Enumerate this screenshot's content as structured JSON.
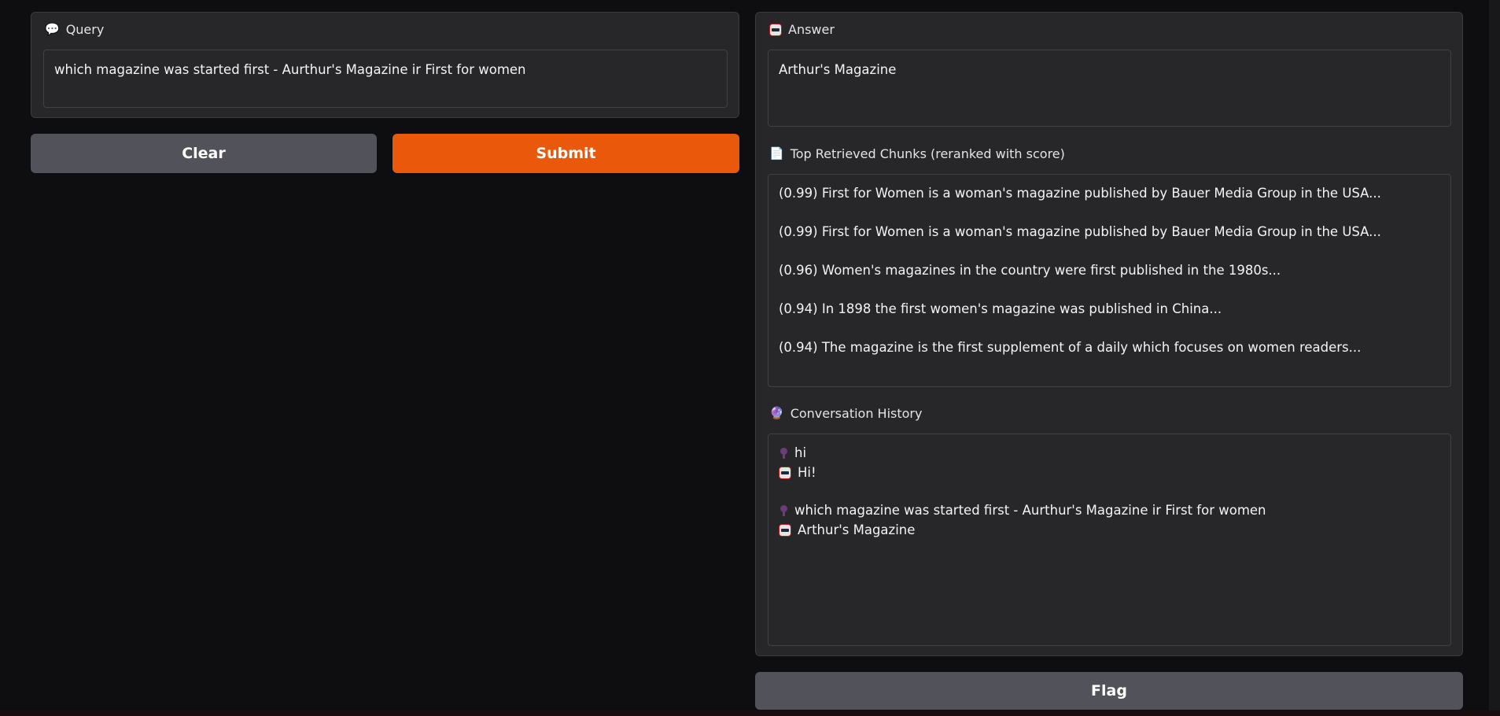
{
  "query": {
    "label": "Query",
    "icon": "speech-bubble-icon",
    "value": "which magazine was started first - Aurthur's Magazine ir First for women"
  },
  "buttons": {
    "clear": "Clear",
    "submit": "Submit",
    "flag": "Flag"
  },
  "answer": {
    "label": "Answer",
    "icon": "robot-icon",
    "value": "Arthur's Magazine"
  },
  "chunks": {
    "label": "Top Retrieved Chunks (reranked with score)",
    "icon": "page-icon",
    "items": [
      "(0.99) First for Women is a woman's magazine published by Bauer Media Group in the USA...",
      "(0.99) First for Women is a woman's magazine published by Bauer Media Group in the USA...",
      "(0.96) Women's magazines in the country were first published in the 1980s...",
      "(0.94) In 1898 the first women's magazine was published in China...",
      "(0.94) The magazine is the first supplement of a daily which focuses on women readers..."
    ]
  },
  "history": {
    "label": "Conversation History",
    "icon": "crystal-ball-icon",
    "turns": [
      {
        "user": "hi",
        "bot": "Hi!"
      },
      {
        "user": "which magazine was started first - Aurthur's Magazine ir First for women",
        "bot": "Arthur's Magazine"
      }
    ]
  },
  "colors": {
    "background": "#0e0e11",
    "panel": "#27272a",
    "primary": "#ea580c",
    "secondary": "#52525b"
  }
}
